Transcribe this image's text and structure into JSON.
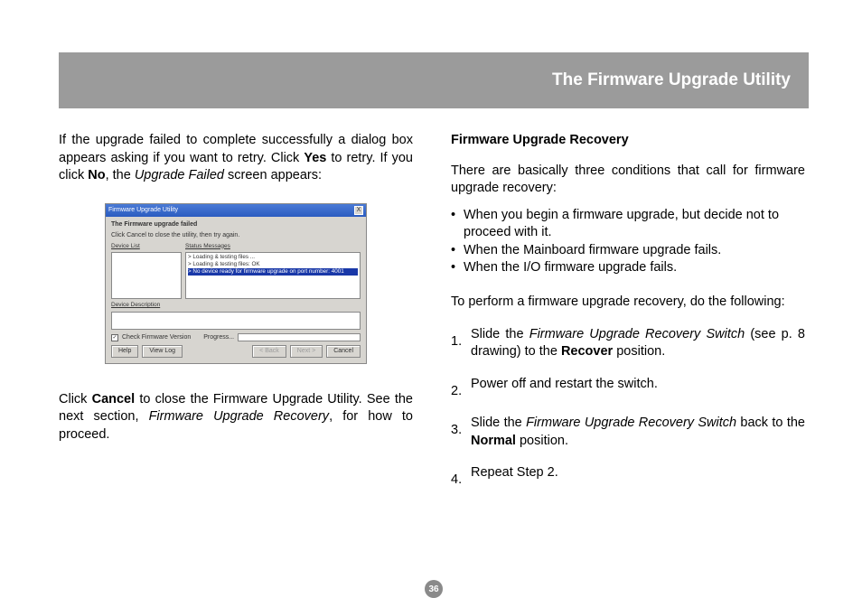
{
  "header": {
    "title": "The Firmware Upgrade Utility"
  },
  "left": {
    "p1_a": "If the upgrade failed to complete successfully a dialog box appears asking if you want to retry. Click ",
    "p1_yes": "Yes",
    "p1_b": " to retry. If you click ",
    "p1_no": "No",
    "p1_c": ", the ",
    "p1_uf": "Upgrade Failed",
    "p1_d": " screen appears:",
    "p2_a": "Click ",
    "p2_cancel": "Cancel",
    "p2_b": " to close the Firmware Upgrade Utility. See the next section, ",
    "p2_fur": "Firmware Upgrade Recovery",
    "p2_c": ", for how to proceed."
  },
  "right": {
    "subhead": "Firmware Upgrade Recovery",
    "intro": "There are basically three conditions that call for firmware upgrade recovery:",
    "bullets": [
      "When you begin a firmware upgrade, but decide not to proceed with it.",
      "When the Mainboard firmware upgrade fails.",
      "When the I/O firmware upgrade fails."
    ],
    "lead": "To perform a firmware upgrade recovery, do the following:",
    "steps": [
      {
        "n": "1.",
        "pre": "Slide the ",
        "it": "Firmware Upgrade Recovery Switch",
        "mid": " (see p. 8 drawing) to the ",
        "b": "Recover",
        "post": " position."
      },
      {
        "n": "2.",
        "plain": "Power off and restart the switch."
      },
      {
        "n": "3.",
        "pre": "Slide the ",
        "it": "Firmware Upgrade Recovery Switch",
        "mid": " back to the ",
        "b": "Normal",
        "post": " position."
      },
      {
        "n": "4.",
        "plain": "Repeat Step 2."
      }
    ]
  },
  "dialog": {
    "title": "Firmware Upgrade Utility",
    "close": "X",
    "msg1": "The Firmware upgrade failed",
    "msg2": "Click Cancel to close the utility, then try again.",
    "device_list_label": "Device List",
    "status_label": "Status Messages",
    "status_lines": [
      "> Loading & testing files ...",
      "> Loading & testing files: OK",
      "> No device ready for firmware upgrade on port number: 4001"
    ],
    "device_desc_label": "Device Description",
    "check_label": "Check Firmware Version",
    "progress_label": "Progress...",
    "buttons": {
      "help": "Help",
      "viewlog": "View Log",
      "next": "Next >",
      "back": "< Back",
      "cancel": "Cancel"
    }
  },
  "page_number": "36"
}
